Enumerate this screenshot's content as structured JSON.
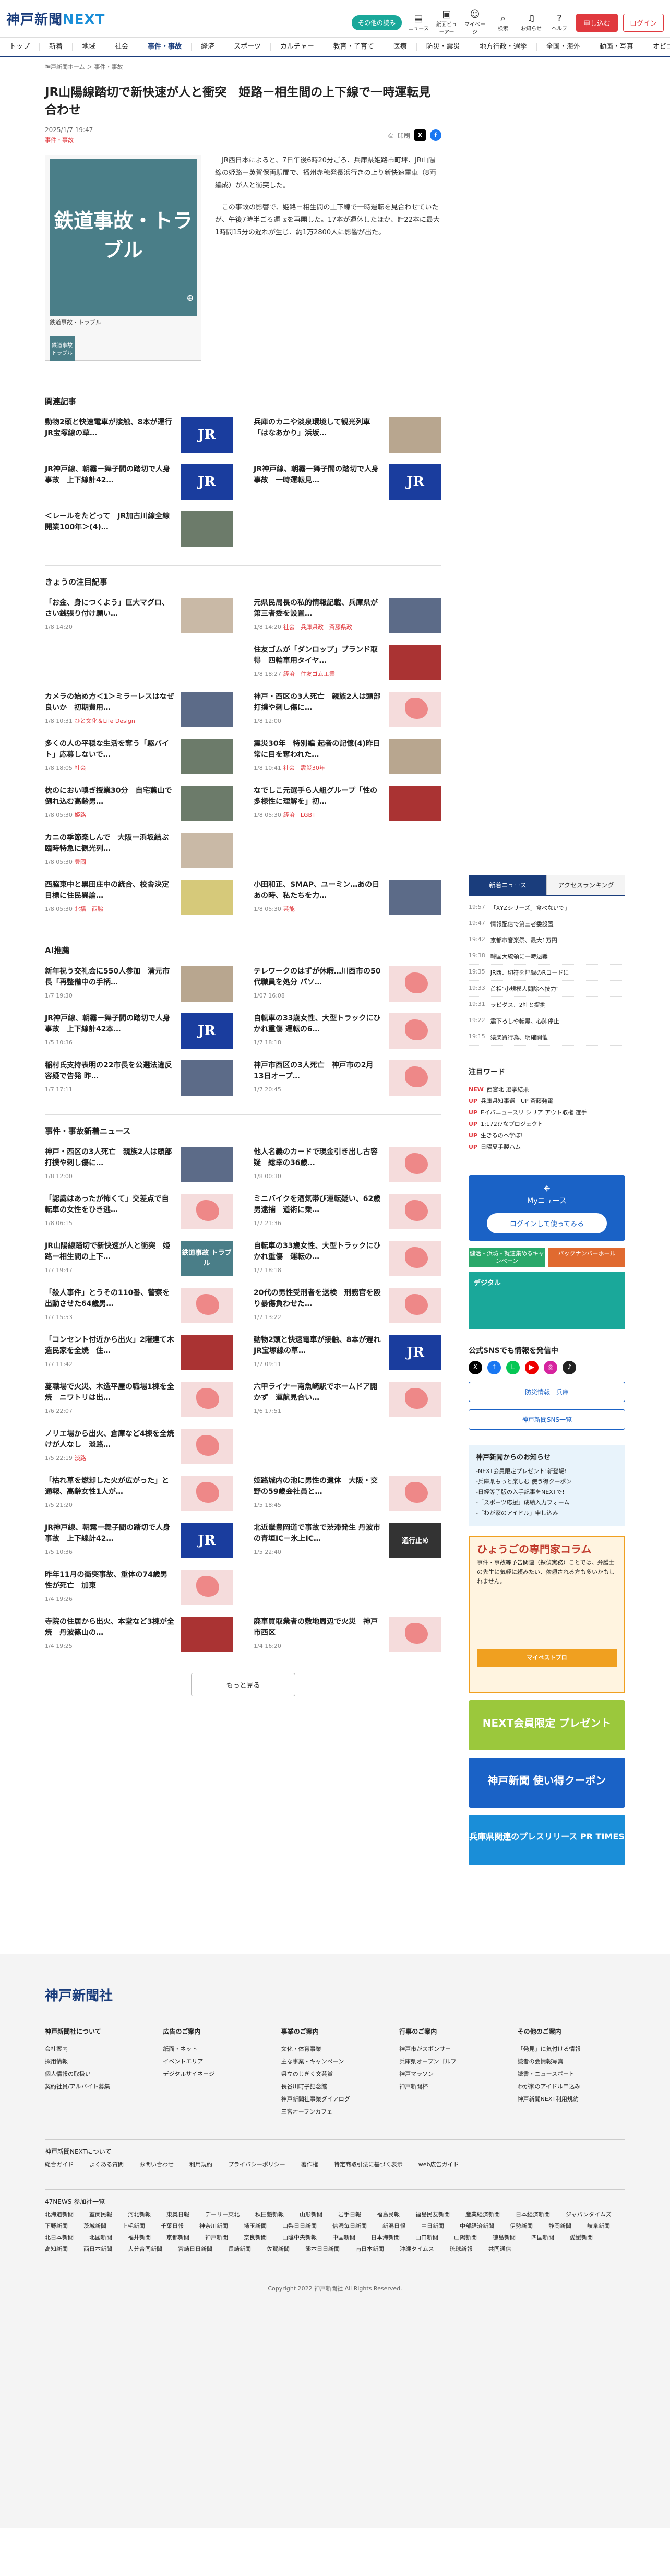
{
  "header": {
    "logo_a": "神戸新聞",
    "logo_b": "NEXT",
    "pill": "その他の読み",
    "icons": [
      "ニュース",
      "紙面ビューアー",
      "マイページ",
      "検索",
      "お知らせ",
      "ヘルプ"
    ],
    "signup": "申し込む",
    "login": "ログイン"
  },
  "nav": [
    "トップ",
    "新着",
    "地域",
    "社会",
    "事件・事故",
    "経済",
    "スポーツ",
    "カルチャー",
    "教育・子育て",
    "医療",
    "防災・震災",
    "地方行政・選挙",
    "全国・海外",
    "動画・写真",
    "オピニオン"
  ],
  "breadcrumb": "神戸新聞ホーム ＞ 事件・事故",
  "article": {
    "title": "JR山陽線踏切で新快速が人と衝突　姫路ー相生間の上下線で一時運転見合わせ",
    "date": "2025/1/7 19:47",
    "category": "事件・事故",
    "print": "印刷",
    "photo_text": "鉄道事故・トラブル",
    "photo_caption": "鉄道事故・トラブル",
    "thumb": "鉄道事故トラブル",
    "p1": "JR西日本によると、7日午後6時20分ごろ、兵庫県姫路市町坪、JR山陽線の姫路－英賀保両駅間で、播州赤穂発長浜行きの上り新快速電車（8両編成）が人と衝突した。",
    "p2": "この事故の影響で、姫路－相生間の上下線で一時運転を見合わせていたが、午後7時半ごろ運転を再開した。17本が運休したほか、計22本に最大1時間15分の遅れが生じ、約1万2800人に影響が出た。"
  },
  "related": {
    "title": "関連記事",
    "items": [
      {
        "t": "動物2頭と快速電車が接触、8本が運行　JR宝塚線の草…",
        "img": "jr"
      },
      {
        "t": "兵庫のカニや淡泉環境して観光列車「はなあかり」浜坂…",
        "img": "p1"
      },
      {
        "t": "JR神戸線、朝霧ー舞子間の踏切で人身事故　上下線計42…",
        "img": "jr"
      },
      {
        "t": "JR神戸線、朝霧ー舞子間の踏切で人身事故　一時運転見…",
        "img": "jr"
      },
      {
        "t": "＜レールをたどって　JR加古川線全線開業100年＞(4)…",
        "img": "p2"
      }
    ]
  },
  "today": {
    "title": "きょうの注目記事",
    "items": [
      {
        "t": "「お金、身につくよう」巨大マグロ、さい銭張り付け願い…",
        "d": "1/8 14:20",
        "img": "p4"
      },
      {
        "t": "元県民局長の私的情報記載、兵庫県が第三者委を設置…",
        "d": "1/8 14:20",
        "c": "社会　兵庫県政　斎藤県政",
        "img": "p5"
      },
      {
        "t": "",
        "d": "",
        "img": ""
      },
      {
        "t": "住友ゴムが「ダンロップ」ブランド取得　四輪車用タイヤ…",
        "d": "1/8 18:27",
        "c": "経済　住友ゴム工業",
        "img": "p3"
      },
      {
        "t": "カメラの始め方＜1＞ミラーレスはなぜ良いか　初期費用…",
        "d": "1/8 10:31",
        "c": "ひと文化＆Life Design",
        "img": "p5"
      },
      {
        "t": "神戸・西区の3人死亡　親族2人は頭部打撲や刺し傷に…",
        "d": "1/8 12:00",
        "img": "map"
      },
      {
        "t": "多くの人の平穏な生活を奪う「駆バイト」応募しないで…",
        "d": "1/8 18:05",
        "c": "社会",
        "img": "p2"
      },
      {
        "t": "震災30年　特別編 起者の記憶(4)昨日常に目を奪われた…",
        "d": "1/8 10:41",
        "c": "社会　震災30年",
        "img": "p1"
      },
      {
        "t": "枕のにおい嗅ぎ授業30分　自宅薫山で倒れ込む高齢男…",
        "d": "1/8 05:30",
        "c": "姫路",
        "img": "p2"
      },
      {
        "t": "なでしこ元選手ら人組グループ「性の多様性に理解を」初…",
        "d": "1/8 05:30",
        "c": "経済　LGBT",
        "img": "p3"
      },
      {
        "t": "カニの季節楽しんで　大阪ー浜坂結ぶ臨時特急に観光列…",
        "d": "1/8 05:30",
        "c": "豊岡",
        "img": "p4"
      },
      {
        "t": "",
        "d": "",
        "img": ""
      },
      {
        "t": "西脇東中と黒田庄中の統合、校舎決定目標に住民異論…",
        "d": "1/8 05:30",
        "c": "北播　西脇",
        "img": "p6"
      },
      {
        "t": "小田和正、SMAP、ユーミン…あの日あの時、私たちを力…",
        "d": "1/8 05:30",
        "c": "芸能",
        "img": "p5"
      }
    ]
  },
  "ai": {
    "title": "AI推薦",
    "items": [
      {
        "t": "新年祝う交礼会に550人参加　清元市長「再整備中の手柄…",
        "d": "1/7 19:30",
        "img": "p1"
      },
      {
        "t": "テレワークのはずが休暇…川西市の50代職員を処分 パソ…",
        "d": "1/07 16:08",
        "img": "map"
      },
      {
        "t": "JR神戸線、朝霧ー舞子間の踏切で人身事故　上下線計42本…",
        "d": "1/5 10:36",
        "img": "jr"
      },
      {
        "t": "自転車の33歳女性、大型トラックにひかれ重傷 運転の6…",
        "d": "1/7 18:18",
        "img": "map"
      },
      {
        "t": "稲村氏支持表明の22市長を公選法違反容疑で告発 昨…",
        "d": "1/7 17:11",
        "img": "p5"
      },
      {
        "t": "神戸市西区の3人死亡　神戸市の2月13日オープ…",
        "d": "1/7 20:45",
        "img": "map"
      }
    ]
  },
  "accident": {
    "title": "事件・事故新着ニュース",
    "items": [
      {
        "t": "神戸・西区の3人死亡　親族2人は頭部打撲や刺し傷に…",
        "d": "1/8 12:00",
        "img": "p5"
      },
      {
        "t": "他人名義のカードで現金引き出し古容疑　総幸の36歳…",
        "d": "1/8 00:30",
        "img": "map"
      },
      {
        "t": "「認識はあったが怖くて」交差点で自転車の女性をひき逃…",
        "d": "1/8 06:15",
        "img": "map"
      },
      {
        "t": "ミニバイクを酒気帯び運転疑い、62歳男逮捕　道術に乗…",
        "d": "1/7 21:36",
        "img": "map"
      },
      {
        "t": "JR山陽線踏切で新快速が人と衝突　姫路ー相生間の上下…",
        "d": "1/7 19:47",
        "img": "rail"
      },
      {
        "t": "自転車の33歳女性、大型トラックにひかれ重傷　運転の…",
        "d": "1/7 18:18",
        "img": "map"
      },
      {
        "t": "「殺人事件」とうその110番、警察を出動させた64歳男…",
        "d": "1/7 15:53",
        "img": "map"
      },
      {
        "t": "20代の男性受刑者を送検　刑務官を殴り暴傷負わせた…",
        "d": "1/7 13:22",
        "img": "map"
      },
      {
        "t": "「コンセント付近から出火」2階建て木造民家を全焼　住…",
        "d": "1/7 11:42",
        "img": "p3"
      },
      {
        "t": "動物2頭と快速電車が接触、8本が遅れ　JR宝塚線の草…",
        "d": "1/7 09:11",
        "img": "jr"
      },
      {
        "t": "蔓職場で火災、木造平屋の職場1棟を全焼　ニワトリは出…",
        "d": "1/6 22:07",
        "img": "map"
      },
      {
        "t": "六甲ライナー南魚崎駅でホームドア開かず　運航見合い…",
        "d": "1/6 17:51",
        "img": "map"
      },
      {
        "t": "ノリエ場から出火、倉庫など4棟を全焼　けが人なし　淡路…",
        "d": "1/5 22:19",
        "c": "淡路",
        "img": "map"
      },
      {
        "t": "",
        "d": "",
        "img": ""
      },
      {
        "t": "「枯れ草を燃却した火が広がった」と通報、高齢女性1人が…",
        "d": "1/5 21:20",
        "img": "map"
      },
      {
        "t": "姫路城内の池に男性の遺体　大阪・交野の59歳会社員と…",
        "d": "1/5 18:45",
        "img": "map"
      },
      {
        "t": "JR神戸線、朝霧ー舞子間の踏切で人身事故　上下線計42…",
        "d": "1/5 10:36",
        "img": "jr"
      },
      {
        "t": "北近畿豊岡道で事故で渋滞発生 丹波市の青垣IC－氷上IC…",
        "d": "1/5 22:40",
        "img": "dark"
      },
      {
        "t": "昨年11月の衝突事故、重体の74歳男性が死亡　加東",
        "d": "1/4 19:26",
        "img": "map"
      },
      {
        "t": "",
        "d": "",
        "img": ""
      },
      {
        "t": "寺院の住居から出火、本堂など3棟が全焼　丹波篠山の…",
        "d": "1/4 19:25",
        "img": "p3"
      },
      {
        "t": "廃車買取業者の敷地周辺で火災　神戸市西区",
        "d": "1/4 16:20",
        "img": "map"
      }
    ],
    "more": "もっと見る"
  },
  "side": {
    "tab_a": "新着ニュース",
    "tab_b": "アクセスランキング",
    "ranks": [
      {
        "tm": "19:57",
        "t": "「XYZシリーズ」食べないで」"
      },
      {
        "tm": "19:47",
        "t": "情報配信で第三者委設置"
      },
      {
        "tm": "19:42",
        "t": "京都市音楽祭、最大1万円"
      },
      {
        "tm": "19:38",
        "t": "韓国大統領に一時退職"
      },
      {
        "tm": "19:35",
        "t": "JR西、切符を記録のRコードに"
      },
      {
        "tm": "19:33",
        "t": "首相\"小規模人間除へ技力\""
      },
      {
        "tm": "19:31",
        "t": "ラピダス、2社と提携"
      },
      {
        "tm": "19:22",
        "t": "震下ろしや転黒、心肺停止"
      },
      {
        "tm": "19:15",
        "t": "猿楽買行為、明確開催"
      }
    ],
    "words_title": "注目ワード",
    "words": [
      {
        "u": "NEW",
        "t": "西宮北 選挙結果"
      },
      {
        "u": "UP",
        "t": "兵庫県知事選　UP 斎藤発電"
      },
      {
        "u": "UP",
        "t": "Eイバニュースリ シリア アウト取権 選手"
      },
      {
        "u": "UP",
        "t": "1:172ひなプロジェクト"
      },
      {
        "u": "UP",
        "t": "生きるのへ学ぼ!"
      },
      {
        "u": "UP",
        "t": "日曜夏手製ハム"
      }
    ],
    "mycue": "Myニュース",
    "mycue_btn": "ログインして使ってみる",
    "b1": "健活・浜坊・就速集めるキャンペーン",
    "b2": "バックナンバーホール",
    "digital": "デジタル",
    "sns_title": "公式SNSでも情報を発信中",
    "sns_btn1": "防災情報　兵庫",
    "sns_btn2": "神戸新聞SNS一覧",
    "notice_title": "神戸新聞からのお知らせ",
    "notice": [
      "-NEXT会員限定プレゼント!新登場!",
      "-兵庫県もっと楽しむ 使う得クーポン",
      "-日経等子版の入手記事をNEXTで!",
      "-「スポーツ応援」成績入力フォーム",
      "-「わが家のアイドル」申し込み"
    ],
    "hyogo_title": "ひょうごの専門家コラム",
    "hyogo_text": "事件・事故等予告関連（探偵実務）ことでは、弁護士の先生に気軽に頼みたい、依頼される方も多いかもしれません。",
    "hyogo_more": "マイベストプロ",
    "promo1": "NEXT会員限定 プレゼント",
    "promo2": "神戸新聞 使い得クーポン",
    "promo3": "兵庫県関連のプレスリリース PR TIMES"
  },
  "footer": {
    "logo": "神戸新聞社",
    "cols": [
      {
        "h": "神戸新聞社について",
        "l": [
          "会社案内",
          "採用情報",
          "個人情報の取扱い",
          "契約社員/アルバイト募集"
        ]
      },
      {
        "h": "広告のご案内",
        "l": [
          "紙面・ネット",
          "イベントエリア",
          "デジタルサイネージ"
        ]
      },
      {
        "h": "事業のご案内",
        "l": [
          "文化・体育事業",
          "主な事業・キャンペーン",
          "県立のじぎく文芸賞",
          "長谷川町子記念館",
          "神戸新聞社事業ダイアログ",
          "三宮オープンカフェ"
        ]
      },
      {
        "h": "行事のご案内",
        "l": [
          "神戸市がスポンサー",
          "兵庫県オープンゴルフ",
          "神戸マラソン",
          "神戸新聞杯"
        ]
      },
      {
        "h": "その他のご案内",
        "l": [
          "「発見」に気付ける情報",
          "読者の会情報写真",
          "読書・ニュースポート",
          "わが家のアイドル申込み",
          "神戸新聞NEXT利用規約"
        ]
      }
    ],
    "next_title": "神戸新聞NEXTについて",
    "next_links": [
      "総合ガイド",
      "よくある質問",
      "お問い合わせ",
      "利用規約",
      "プライバシーポリシー",
      "著作権",
      "特定商取引法に基づく表示",
      "web広告ガイド"
    ],
    "s47": "47NEWS 参加社一覧",
    "papers": [
      "北海道新聞",
      "室蘭民報",
      "河北新報",
      "東奥日報",
      "デーリー東北",
      "秋田魁新報",
      "山形新聞",
      "岩手日報",
      "福島民報",
      "福島民友新聞",
      "産業経済新聞",
      "日本経済新聞",
      "ジャパンタイムズ",
      "下野新聞",
      "茨城新聞",
      "上毛新聞",
      "千葉日報",
      "神奈川新聞",
      "埼玉新聞",
      "山梨日日新聞",
      "信濃毎日新聞",
      "新潟日報",
      "中日新聞",
      "中部経済新聞",
      "伊勢新聞",
      "静岡新聞",
      "岐阜新聞",
      "北日本新聞",
      "北國新聞",
      "福井新聞",
      "京都新聞",
      "神戸新聞",
      "奈良新聞",
      "山陰中央新報",
      "中国新聞",
      "日本海新聞",
      "山口新聞",
      "山陽新聞",
      "徳島新聞",
      "四国新聞",
      "愛媛新聞",
      "高知新聞",
      "西日本新聞",
      "大分合同新聞",
      "宮崎日日新聞",
      "長崎新聞",
      "佐賀新聞",
      "熊本日日新聞",
      "南日本新聞",
      "沖縄タイムス",
      "琉球新報",
      "共同通信"
    ],
    "copy": "Copyright 2022 神戸新聞社 All Rights Reserved."
  }
}
